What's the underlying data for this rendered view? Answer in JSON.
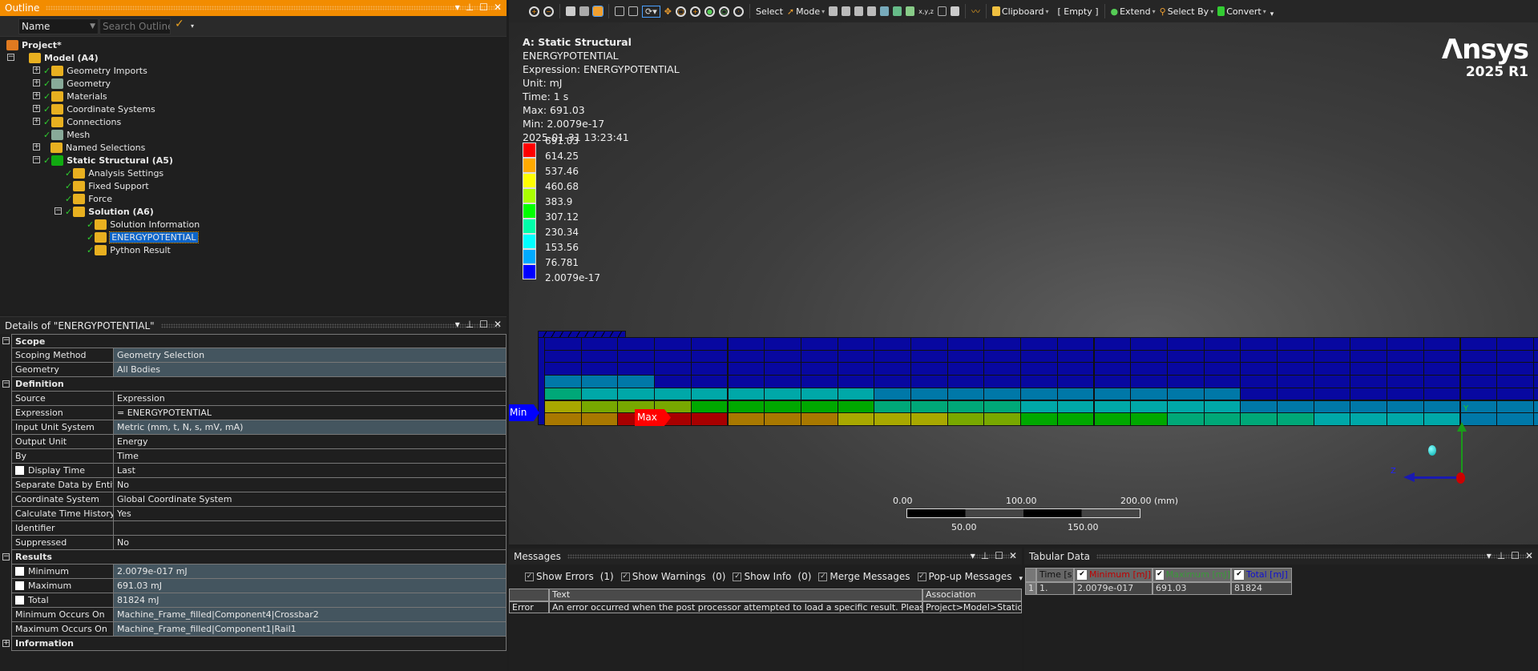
{
  "outline": {
    "title": "Outline",
    "filter_select": "Name",
    "search_placeholder": "Search Outline",
    "tree": [
      {
        "label": "Project*",
        "level": 0,
        "bold": true
      },
      {
        "label": "Model (A4)",
        "level": 1,
        "bold": true,
        "expander": "minus"
      },
      {
        "label": "Geometry Imports",
        "level": 2,
        "expander": "plus",
        "check": true,
        "icon": "folder-geometry-imports-icon"
      },
      {
        "label": "Geometry",
        "level": 2,
        "expander": "plus",
        "check": true,
        "icon": "geometry-icon"
      },
      {
        "label": "Materials",
        "level": 2,
        "expander": "plus",
        "check": true,
        "icon": "materials-icon"
      },
      {
        "label": "Coordinate Systems",
        "level": 2,
        "expander": "plus",
        "check": true,
        "icon": "coordinate-systems-icon"
      },
      {
        "label": "Connections",
        "level": 2,
        "expander": "plus",
        "check": true,
        "icon": "connections-icon"
      },
      {
        "label": "Mesh",
        "level": 2,
        "check": true,
        "icon": "mesh-icon"
      },
      {
        "label": "Named Selections",
        "level": 2,
        "expander": "plus",
        "icon": "named-selections-icon"
      },
      {
        "label": "Static Structural (A5)",
        "level": 2,
        "bold": true,
        "expander": "minus",
        "check": true,
        "icon": "static-structural-icon"
      },
      {
        "label": "Analysis Settings",
        "level": 3,
        "check": true,
        "icon": "analysis-settings-icon"
      },
      {
        "label": "Fixed Support",
        "level": 3,
        "check": true,
        "icon": "fixed-support-icon"
      },
      {
        "label": "Force",
        "level": 3,
        "check": true,
        "icon": "force-icon"
      },
      {
        "label": "Solution (A6)",
        "level": 3,
        "bold": true,
        "expander": "minus",
        "check": true,
        "icon": "solution-icon"
      },
      {
        "label": "Solution Information",
        "level": 4,
        "check": true,
        "icon": "solution-information-icon"
      },
      {
        "label": "ENERGYPOTENTIAL",
        "level": 4,
        "check": true,
        "selected": true,
        "icon": "user-result-icon"
      },
      {
        "label": "Python Result",
        "level": 4,
        "check": true,
        "icon": "python-result-icon"
      }
    ]
  },
  "details": {
    "title": "Details of \"ENERGYPOTENTIAL\"",
    "rows": [
      {
        "section": "Scope"
      },
      {
        "key": "Scoping Method",
        "value": "Geometry Selection",
        "hl": true
      },
      {
        "key": "Geometry",
        "value": "All Bodies",
        "hl": true
      },
      {
        "section": "Definition"
      },
      {
        "key": "Source",
        "value": "Expression"
      },
      {
        "key": "Expression",
        "value": "= ENERGYPOTENTIAL"
      },
      {
        "key": "Input Unit System",
        "value": "Metric (mm, t, N, s, mV, mA)",
        "hl": true
      },
      {
        "key": "Output Unit",
        "value": "Energy"
      },
      {
        "key": "By",
        "value": "Time"
      },
      {
        "key": "Display Time",
        "value": "Last",
        "checkbox": true
      },
      {
        "key": "Separate Data by Entity",
        "value": "No"
      },
      {
        "key": "Coordinate System",
        "value": "Global Coordinate System"
      },
      {
        "key": "Calculate Time History",
        "value": "Yes"
      },
      {
        "key": "Identifier",
        "value": ""
      },
      {
        "key": "Suppressed",
        "value": "No"
      },
      {
        "section": "Results"
      },
      {
        "key": "Minimum",
        "value": "2.0079e-017 mJ",
        "hl": true,
        "checkbox": true
      },
      {
        "key": "Maximum",
        "value": "691.03 mJ",
        "hl": true,
        "checkbox": true
      },
      {
        "key": "Total",
        "value": "81824 mJ",
        "hl": true,
        "checkbox": true
      },
      {
        "key": "Minimum Occurs On",
        "value": "Machine_Frame_filled|Component4|Crossbar2",
        "hl": true
      },
      {
        "key": "Maximum Occurs On",
        "value": "Machine_Frame_filled|Component1|Rail1",
        "hl": true
      },
      {
        "section": "Information",
        "collapsed": true
      }
    ]
  },
  "toolbar": {
    "select": "Select",
    "mode": "Mode",
    "clipboard": "Clipboard",
    "empty": "[ Empty ]",
    "extend": "Extend",
    "select_by": "Select By",
    "convert": "Convert"
  },
  "viewport": {
    "title": "A: Static Structural",
    "lines": [
      "ENERGYPOTENTIAL",
      "Expression: ENERGYPOTENTIAL",
      "Unit: mJ",
      "Time: 1 s",
      "Max: 691.03",
      "Min: 2.0079e-17",
      "2025-01-31 13:23:41"
    ],
    "logo": "Ansys",
    "version": "2025 R1",
    "legend": {
      "labels": [
        "691.03",
        "614.25",
        "537.46",
        "460.68",
        "383.9",
        "307.12",
        "230.34",
        "153.56",
        "76.781",
        "2.0079e-17"
      ],
      "colors": [
        "#ff0000",
        "#ffaa00",
        "#ffff00",
        "#aaff00",
        "#00ff00",
        "#00ffaa",
        "#00ffff",
        "#00aaff",
        "#0000ff"
      ]
    },
    "shaded_colors": [
      "#0808a0",
      "#0078a8",
      "#00a8a8",
      "#00a878",
      "#00a800",
      "#78a800",
      "#a8a800",
      "#a87800",
      "#a80000"
    ],
    "contour_bands": [
      [
        0,
        0,
        0,
        0,
        0,
        0,
        0,
        0,
        0,
        0,
        0,
        0,
        0,
        0,
        0,
        0,
        0,
        0,
        0,
        0,
        0,
        0,
        0,
        0,
        0,
        0,
        0,
        0
      ],
      [
        0,
        0,
        0,
        0,
        0,
        0,
        0,
        0,
        0,
        0,
        0,
        0,
        0,
        0,
        0,
        0,
        0,
        0,
        0,
        0,
        0,
        0,
        0,
        0,
        0,
        0,
        0,
        0
      ],
      [
        0,
        0,
        0,
        0,
        0,
        0,
        0,
        0,
        0,
        0,
        0,
        0,
        0,
        0,
        0,
        0,
        0,
        0,
        0,
        0,
        0,
        0,
        0,
        0,
        0,
        0,
        0,
        0
      ],
      [
        1,
        1,
        1,
        0,
        0,
        0,
        0,
        0,
        0,
        0,
        0,
        0,
        0,
        0,
        0,
        0,
        0,
        0,
        0,
        0,
        0,
        0,
        0,
        0,
        0,
        0,
        0,
        0
      ],
      [
        3,
        2,
        2,
        2,
        2,
        2,
        2,
        2,
        2,
        1,
        1,
        1,
        1,
        1,
        1,
        1,
        1,
        1,
        1,
        0,
        0,
        0,
        0,
        0,
        0,
        0,
        0,
        0
      ],
      [
        6,
        5,
        5,
        5,
        4,
        4,
        4,
        4,
        4,
        3,
        3,
        3,
        3,
        2,
        2,
        2,
        2,
        2,
        2,
        1,
        1,
        1,
        1,
        1,
        1,
        1,
        1,
        1
      ],
      [
        7,
        7,
        8,
        8,
        8,
        7,
        7,
        7,
        6,
        6,
        6,
        5,
        5,
        4,
        4,
        4,
        4,
        3,
        3,
        3,
        3,
        2,
        2,
        2,
        2,
        1,
        1,
        1
      ]
    ],
    "min_tag": "Min",
    "max_tag": "Max",
    "scale": {
      "top": [
        "0.00",
        "100.00",
        "200.00 (mm)"
      ],
      "bottom": [
        "50.00",
        "150.00"
      ]
    },
    "triad": {
      "y": "Y",
      "z": "Z"
    }
  },
  "messages": {
    "title": "Messages",
    "filters": [
      {
        "label": "Show Errors",
        "count": "(1)"
      },
      {
        "label": "Show Warnings",
        "count": "(0)"
      },
      {
        "label": "Show Info",
        "count": "(0)"
      },
      {
        "label": "Merge Messages",
        "count": ""
      },
      {
        "label": "Pop-up Messages",
        "count": ""
      }
    ],
    "columns": [
      "",
      "Text",
      "Association"
    ],
    "rows": [
      [
        "Error",
        "An error occurred when the post processor attempted to load a specific result. Please revi",
        "Project>Model>Static S"
      ]
    ]
  },
  "tabular": {
    "title": "Tabular Data",
    "columns": [
      {
        "label": "Time [s]",
        "color": "#111111"
      },
      {
        "label": "Minimum [mJ]",
        "color": "#c00000"
      },
      {
        "label": "Maximum [mJ]",
        "color": "#3a9a3a"
      },
      {
        "label": "Total [mJ]",
        "color": "#1010d0"
      }
    ],
    "rows": [
      [
        "1",
        "1.",
        "2.0079e-017",
        "691.03",
        "81824"
      ]
    ]
  }
}
